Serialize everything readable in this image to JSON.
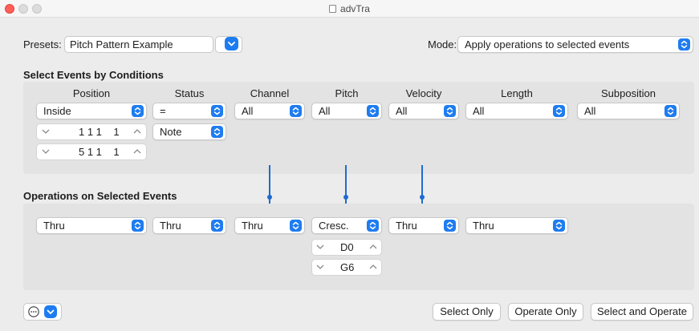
{
  "window": {
    "title": "advTra"
  },
  "presets": {
    "label": "Presets:",
    "value": "Pitch Pattern Example"
  },
  "mode": {
    "label": "Mode:",
    "value": "Apply operations to selected events"
  },
  "conditions": {
    "title": "Select Events by Conditions",
    "columns": [
      "Position",
      "Status",
      "Channel",
      "Pitch",
      "Velocity",
      "Length",
      "Subposition"
    ],
    "position": {
      "value": "Inside",
      "from": "1 1 1    1",
      "to": "5 1 1    1"
    },
    "status": {
      "value": "=",
      "sub": "Note"
    },
    "channel": "All",
    "pitch": "All",
    "velocity": "All",
    "length": "All",
    "subposition": "All"
  },
  "operations": {
    "title": "Operations on Selected Events",
    "position": "Thru",
    "status": "Thru",
    "channel": "Thru",
    "pitch": {
      "value": "Cresc.",
      "from": "D0",
      "to": "G6"
    },
    "velocity": "Thru",
    "length": "Thru"
  },
  "footer": {
    "select_only": "Select Only",
    "operate_only": "Operate Only",
    "select_and_operate": "Select and Operate"
  },
  "colors": {
    "accent": "#1e7cf0",
    "link_line": "#1e6bd0"
  }
}
